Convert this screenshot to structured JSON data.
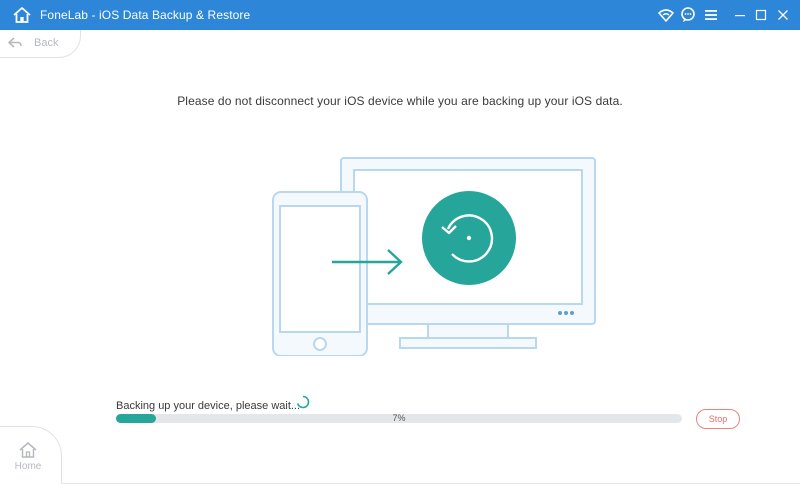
{
  "window": {
    "title": "FoneLab - iOS Data Backup & Restore"
  },
  "nav": {
    "back_label": "Back",
    "home_label": "Home"
  },
  "main": {
    "message": "Please do not disconnect your iOS device while you are backing up your iOS data."
  },
  "progress": {
    "status_text": "Backing up your device, please wait...",
    "percent_label": "7%",
    "value": 0.07,
    "stop_label": "Stop"
  },
  "colors": {
    "titlebar": "#2d86d8",
    "accent": "#26a69a",
    "stop": "#e86a6a",
    "illustration_line": "#b9d7ee"
  },
  "icons": {
    "app": "home-icon",
    "titlebar_buttons": [
      "wifi-icon",
      "chat-icon",
      "menu-icon",
      "minimize-icon",
      "maximize-icon",
      "close-icon"
    ],
    "back": "back-arrow-icon",
    "home": "home-icon"
  }
}
